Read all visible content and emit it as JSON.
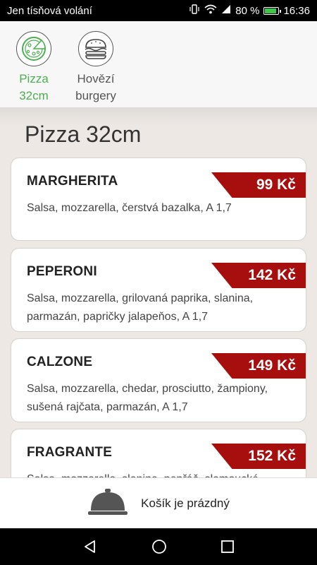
{
  "status_bar": {
    "carrier": "Jen tísňová volání",
    "battery": "80 %",
    "time": "16:36",
    "battery_level": 0.8
  },
  "categories": [
    {
      "label_line1": "Pizza",
      "label_line2": "32cm",
      "icon": "pizza-icon",
      "active": true
    },
    {
      "label_line1": "Hovězí",
      "label_line2": "burgery",
      "icon": "burger-icon",
      "active": false
    }
  ],
  "section_title": "Pizza 32cm",
  "items": [
    {
      "name": "MARGHERITA",
      "desc": "Salsa, mozzarella, čerstvá bazalka, A 1,7",
      "price": "99 Kč"
    },
    {
      "name": "PEPERONI",
      "desc": "Salsa, mozzarella, grilovaná paprika, slanina, parmazán, papričky jalapeňos, A 1,7",
      "price": "142 Kč"
    },
    {
      "name": "CALZONE",
      "desc": "Salsa, mozzarella, chedar, prosciutto, žampiony, sušená rajčata, parmazán, A 1,7",
      "price": "149 Kč"
    },
    {
      "name": "FRAGRANTE",
      "desc": "Salsa, mozzarella, slanina, pepřáč, slamoucké",
      "price": "152 Kč"
    }
  ],
  "cart": {
    "text": "Košík je prázdný",
    "icon": "cloche-icon"
  },
  "colors": {
    "accent_green": "#4caf50",
    "price_red": "#a70f0f"
  }
}
